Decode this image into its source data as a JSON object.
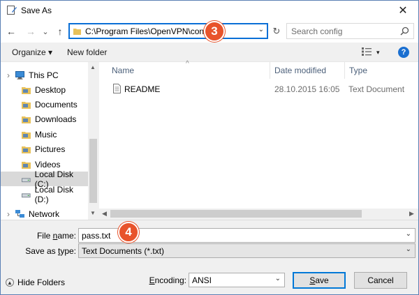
{
  "window": {
    "title": "Save As",
    "close_glyph": "✕"
  },
  "nav": {
    "back_glyph": "←",
    "forward_glyph": "→",
    "recent_glyph": "⌄",
    "up_glyph": "↑",
    "address": "C:\\Program Files\\OpenVPN\\config",
    "refresh_glyph": "↻",
    "search_placeholder": "Search config"
  },
  "toolbar": {
    "organize": "Organize ▾",
    "new_folder": "New folder",
    "help": "?"
  },
  "tree": [
    {
      "label": "This PC",
      "icon": "pc-icon",
      "indent": 1
    },
    {
      "label": "Desktop",
      "icon": "folder-icon",
      "indent": 2
    },
    {
      "label": "Documents",
      "icon": "folder-icon",
      "indent": 2
    },
    {
      "label": "Downloads",
      "icon": "folder-icon",
      "indent": 2
    },
    {
      "label": "Music",
      "icon": "folder-icon",
      "indent": 2
    },
    {
      "label": "Pictures",
      "icon": "folder-icon",
      "indent": 2
    },
    {
      "label": "Videos",
      "icon": "folder-icon",
      "indent": 2
    },
    {
      "label": "Local Disk (C:)",
      "icon": "drive-icon",
      "indent": 2,
      "selected": true
    },
    {
      "label": "Local Disk (D:)",
      "icon": "drive-icon",
      "indent": 2
    },
    {
      "label": "Network",
      "icon": "network-icon",
      "indent": 1
    }
  ],
  "columns": {
    "name": "Name",
    "date": "Date modified",
    "type": "Type",
    "sort_glyph": "^"
  },
  "files": [
    {
      "name": "README",
      "date": "28.10.2015 16:05",
      "type": "Text Document"
    }
  ],
  "form": {
    "file_name_label_pre": "File ",
    "file_name_label_u": "n",
    "file_name_label_post": "ame:",
    "file_name_value": "pass.txt",
    "save_type_label_pre": "Save as ",
    "save_type_label_u": "t",
    "save_type_label_post": "ype:",
    "save_type_value": "Text Documents (*.txt)",
    "encoding_label_pre": "",
    "encoding_label_u": "E",
    "encoding_label_post": "ncoding:",
    "encoding_value": "ANSI",
    "save_button_u": "S",
    "save_button_post": "ave",
    "cancel_button": "Cancel",
    "hide_folders": "Hide Folders"
  },
  "callouts": {
    "step_address": "3",
    "step_filename": "4"
  },
  "colors": {
    "callout": "#e8532b",
    "focus": "#0078d7",
    "folder": "#e8c15a"
  }
}
